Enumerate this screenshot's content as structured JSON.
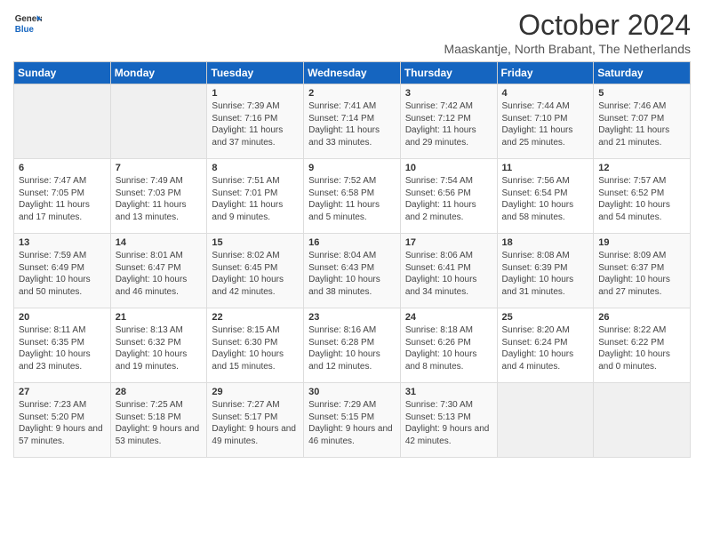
{
  "header": {
    "logo_line1": "General",
    "logo_line2": "Blue",
    "month_title": "October 2024",
    "location": "Maaskantje, North Brabant, The Netherlands"
  },
  "days_of_week": [
    "Sunday",
    "Monday",
    "Tuesday",
    "Wednesday",
    "Thursday",
    "Friday",
    "Saturday"
  ],
  "weeks": [
    [
      {
        "day": "",
        "info": ""
      },
      {
        "day": "",
        "info": ""
      },
      {
        "day": "1",
        "info": "Sunrise: 7:39 AM\nSunset: 7:16 PM\nDaylight: 11 hours and 37 minutes."
      },
      {
        "day": "2",
        "info": "Sunrise: 7:41 AM\nSunset: 7:14 PM\nDaylight: 11 hours and 33 minutes."
      },
      {
        "day": "3",
        "info": "Sunrise: 7:42 AM\nSunset: 7:12 PM\nDaylight: 11 hours and 29 minutes."
      },
      {
        "day": "4",
        "info": "Sunrise: 7:44 AM\nSunset: 7:10 PM\nDaylight: 11 hours and 25 minutes."
      },
      {
        "day": "5",
        "info": "Sunrise: 7:46 AM\nSunset: 7:07 PM\nDaylight: 11 hours and 21 minutes."
      }
    ],
    [
      {
        "day": "6",
        "info": "Sunrise: 7:47 AM\nSunset: 7:05 PM\nDaylight: 11 hours and 17 minutes."
      },
      {
        "day": "7",
        "info": "Sunrise: 7:49 AM\nSunset: 7:03 PM\nDaylight: 11 hours and 13 minutes."
      },
      {
        "day": "8",
        "info": "Sunrise: 7:51 AM\nSunset: 7:01 PM\nDaylight: 11 hours and 9 minutes."
      },
      {
        "day": "9",
        "info": "Sunrise: 7:52 AM\nSunset: 6:58 PM\nDaylight: 11 hours and 5 minutes."
      },
      {
        "day": "10",
        "info": "Sunrise: 7:54 AM\nSunset: 6:56 PM\nDaylight: 11 hours and 2 minutes."
      },
      {
        "day": "11",
        "info": "Sunrise: 7:56 AM\nSunset: 6:54 PM\nDaylight: 10 hours and 58 minutes."
      },
      {
        "day": "12",
        "info": "Sunrise: 7:57 AM\nSunset: 6:52 PM\nDaylight: 10 hours and 54 minutes."
      }
    ],
    [
      {
        "day": "13",
        "info": "Sunrise: 7:59 AM\nSunset: 6:49 PM\nDaylight: 10 hours and 50 minutes."
      },
      {
        "day": "14",
        "info": "Sunrise: 8:01 AM\nSunset: 6:47 PM\nDaylight: 10 hours and 46 minutes."
      },
      {
        "day": "15",
        "info": "Sunrise: 8:02 AM\nSunset: 6:45 PM\nDaylight: 10 hours and 42 minutes."
      },
      {
        "day": "16",
        "info": "Sunrise: 8:04 AM\nSunset: 6:43 PM\nDaylight: 10 hours and 38 minutes."
      },
      {
        "day": "17",
        "info": "Sunrise: 8:06 AM\nSunset: 6:41 PM\nDaylight: 10 hours and 34 minutes."
      },
      {
        "day": "18",
        "info": "Sunrise: 8:08 AM\nSunset: 6:39 PM\nDaylight: 10 hours and 31 minutes."
      },
      {
        "day": "19",
        "info": "Sunrise: 8:09 AM\nSunset: 6:37 PM\nDaylight: 10 hours and 27 minutes."
      }
    ],
    [
      {
        "day": "20",
        "info": "Sunrise: 8:11 AM\nSunset: 6:35 PM\nDaylight: 10 hours and 23 minutes."
      },
      {
        "day": "21",
        "info": "Sunrise: 8:13 AM\nSunset: 6:32 PM\nDaylight: 10 hours and 19 minutes."
      },
      {
        "day": "22",
        "info": "Sunrise: 8:15 AM\nSunset: 6:30 PM\nDaylight: 10 hours and 15 minutes."
      },
      {
        "day": "23",
        "info": "Sunrise: 8:16 AM\nSunset: 6:28 PM\nDaylight: 10 hours and 12 minutes."
      },
      {
        "day": "24",
        "info": "Sunrise: 8:18 AM\nSunset: 6:26 PM\nDaylight: 10 hours and 8 minutes."
      },
      {
        "day": "25",
        "info": "Sunrise: 8:20 AM\nSunset: 6:24 PM\nDaylight: 10 hours and 4 minutes."
      },
      {
        "day": "26",
        "info": "Sunrise: 8:22 AM\nSunset: 6:22 PM\nDaylight: 10 hours and 0 minutes."
      }
    ],
    [
      {
        "day": "27",
        "info": "Sunrise: 7:23 AM\nSunset: 5:20 PM\nDaylight: 9 hours and 57 minutes."
      },
      {
        "day": "28",
        "info": "Sunrise: 7:25 AM\nSunset: 5:18 PM\nDaylight: 9 hours and 53 minutes."
      },
      {
        "day": "29",
        "info": "Sunrise: 7:27 AM\nSunset: 5:17 PM\nDaylight: 9 hours and 49 minutes."
      },
      {
        "day": "30",
        "info": "Sunrise: 7:29 AM\nSunset: 5:15 PM\nDaylight: 9 hours and 46 minutes."
      },
      {
        "day": "31",
        "info": "Sunrise: 7:30 AM\nSunset: 5:13 PM\nDaylight: 9 hours and 42 minutes."
      },
      {
        "day": "",
        "info": ""
      },
      {
        "day": "",
        "info": ""
      }
    ]
  ]
}
